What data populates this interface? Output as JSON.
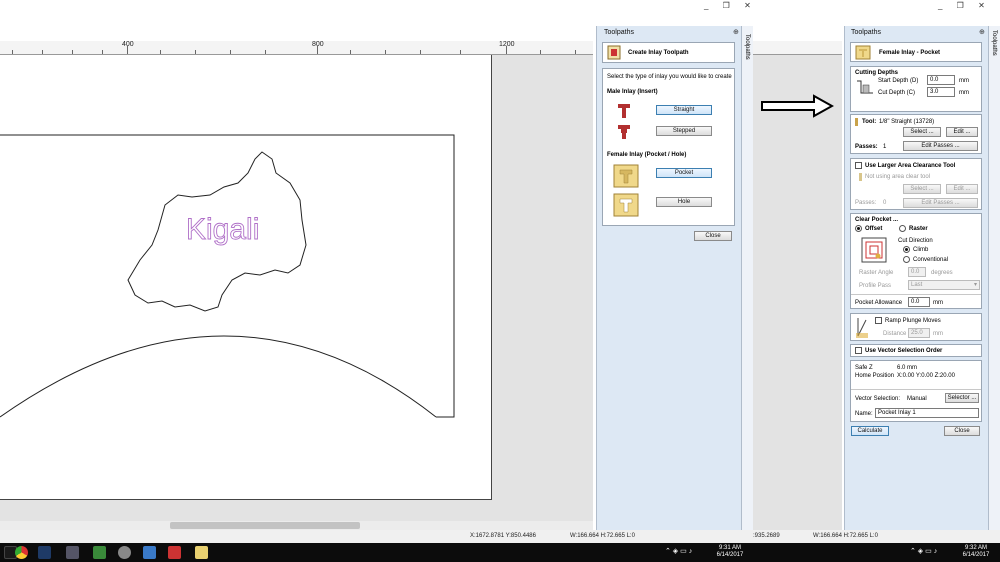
{
  "window": {
    "controls_left": "_ ❐ ✕",
    "controls_right": "_ ❐ ✕"
  },
  "ruler": {
    "labels": [
      "400",
      "800",
      "1200"
    ]
  },
  "canvas": {
    "design_text": "Kigali"
  },
  "left_panel": {
    "header": "Toolpaths",
    "title": "Create Inlay Toolpath",
    "instruction": "Select the type of inlay you would like to create",
    "male_heading": "Male Inlay (Insert)",
    "straight_label": "Straight",
    "stepped_label": "Stepped",
    "female_heading": "Female Inlay (Pocket / Hole)",
    "pocket_label": "Pocket",
    "hole_label": "Hole",
    "close_label": "Close",
    "side_tab": "Toolpaths"
  },
  "right_panel": {
    "header": "Toolpaths",
    "side_tab": "Toolpaths",
    "title": "Female Inlay - Pocket",
    "cutting_depths": "Cutting Depths",
    "start_depth_label": "Start Depth (D)",
    "start_depth_value": "0.0",
    "cut_depth_label": "Cut Depth (C)",
    "cut_depth_value": "3.0",
    "unit_mm": "mm",
    "tool_label": "Tool:",
    "tool_value": "1/8\" Straight (13728)",
    "select_label": "Select ...",
    "edit_label": "Edit ...",
    "passes_label": "Passes:",
    "passes_value": "1",
    "edit_passes_label": "Edit Passes ...",
    "larger_area_label": "Use Larger Area Clearance Tool",
    "not_using_label": "Not using area clear tool",
    "passes2_value": "0",
    "clear_pocket_label": "Clear Pocket ...",
    "offset_label": "Offset",
    "raster_label": "Raster",
    "cut_direction_label": "Cut Direction",
    "climb_label": "Climb",
    "conventional_label": "Conventional",
    "raster_angle_label": "Raster Angle",
    "raster_angle_value": "0.0",
    "degrees_label": "degrees",
    "profile_pass_label": "Profile Pass",
    "profile_pass_value": "Last",
    "pocket_allowance_label": "Pocket Allowance",
    "pocket_allowance_value": "0.0",
    "ramp_label": "Ramp Plunge Moves",
    "distance_label": "Distance",
    "distance_value": "25.0",
    "vector_order_label": "Use Vector Selection Order",
    "safe_z_label": "Safe Z",
    "safe_z_value": "6.0 mm",
    "home_label": "Home Position",
    "home_value": "X:0.00 Y:0.00 Z:20.00",
    "vector_selection_label": "Vector Selection:",
    "vector_selection_value": "Manual",
    "selector_label": "Selector ...",
    "name_label": "Name:",
    "name_value": "Pocket Inlay 1",
    "calculate_label": "Calculate",
    "close_label": "Close"
  },
  "status": {
    "left_coords": "X:1672.8781 Y:850.4486",
    "left_size": "W:166.664  H:72.665  L:0",
    "right_coords": ":935.2689",
    "right_size": "W:166.664  H:72.665  L:0"
  },
  "clock": {
    "time1": "9:31 AM",
    "date1": "6/14/2017",
    "time2": "9:32 AM",
    "date2": "6/14/2017"
  },
  "colors": {
    "accent": "#3c7fb1",
    "panel": "#dde8f4",
    "text_outline": "#b070c8"
  }
}
